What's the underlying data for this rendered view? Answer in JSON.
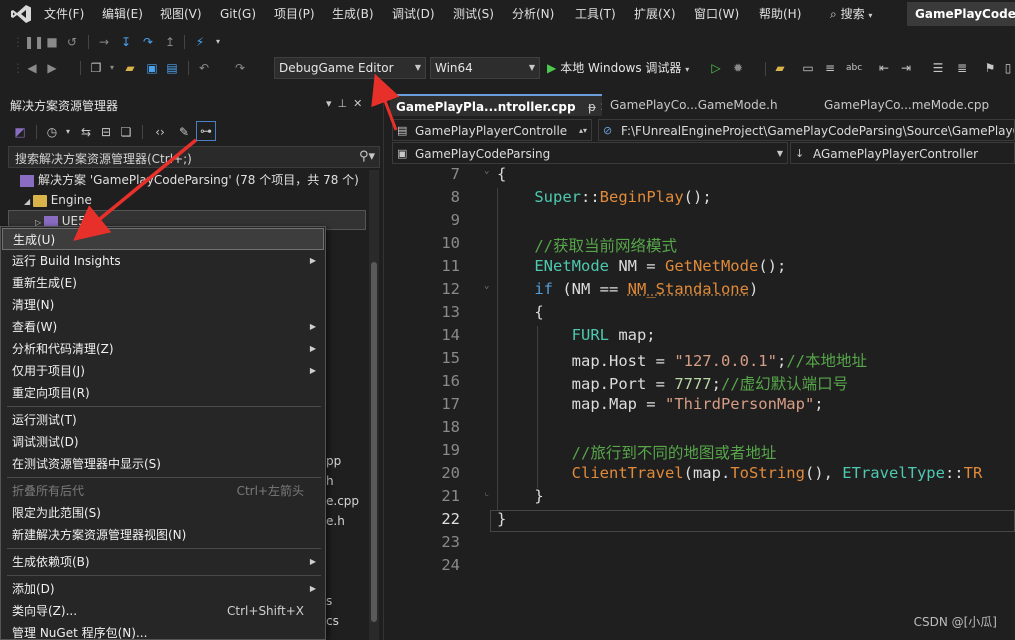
{
  "menu": [
    "文件(F)",
    "编辑(E)",
    "视图(V)",
    "Git(G)",
    "项目(P)",
    "生成(B)",
    "调试(D)",
    "测试(S)",
    "分析(N)",
    "工具(T)",
    "扩展(X)",
    "窗口(W)",
    "帮助(H)"
  ],
  "search_label": "搜索",
  "solution_name": "GamePlayCodeP",
  "toolbar": {
    "config": "DebugGame Editor",
    "platform": "Win64",
    "run_label": "本地 Windows 调试器"
  },
  "solution_explorer": {
    "title": "解决方案资源管理器",
    "search_placeholder": "搜索解决方案资源管理器(Ctrl+;)",
    "solution_row": "解决方案 'GamePlayCodeParsing' (78 个项目，共 78 个)",
    "engine_folder": "Engine",
    "ue_item": "UE5",
    "partial_files": [
      "pp",
      "h",
      "e.cpp",
      "e.h",
      "s",
      "cs"
    ]
  },
  "context_menu": [
    {
      "label": "生成(U)",
      "enabled": true,
      "submenu": false,
      "highlight": true
    },
    {
      "label": "运行 Build Insights",
      "enabled": true,
      "submenu": true
    },
    {
      "label": "重新生成(E)",
      "enabled": true,
      "submenu": false
    },
    {
      "label": "清理(N)",
      "enabled": true,
      "submenu": false
    },
    {
      "label": "查看(W)",
      "enabled": true,
      "submenu": true
    },
    {
      "label": "分析和代码清理(Z)",
      "enabled": true,
      "submenu": true
    },
    {
      "label": "仅用于项目(J)",
      "enabled": true,
      "submenu": true
    },
    {
      "label": "重定向项目(R)",
      "enabled": true,
      "submenu": false
    },
    {
      "label": "运行测试(T)",
      "enabled": true,
      "submenu": false,
      "sep_before": true
    },
    {
      "label": "调试测试(D)",
      "enabled": true,
      "submenu": false
    },
    {
      "label": "在测试资源管理器中显示(S)",
      "enabled": true,
      "submenu": false
    },
    {
      "label": "折叠所有后代",
      "enabled": false,
      "submenu": false,
      "shortcut": "Ctrl+左箭头",
      "sep_before": true
    },
    {
      "label": "限定为此范围(S)",
      "enabled": true,
      "submenu": false
    },
    {
      "label": "新建解决方案资源管理器视图(N)",
      "enabled": true,
      "submenu": false
    },
    {
      "label": "生成依赖项(B)",
      "enabled": true,
      "submenu": true,
      "sep_before": true
    },
    {
      "label": "添加(D)",
      "enabled": true,
      "submenu": true,
      "sep_before": true
    },
    {
      "label": "类向导(Z)...",
      "enabled": true,
      "submenu": false,
      "shortcut": "Ctrl+Shift+X"
    },
    {
      "label": "管理 NuGet 程序包(N)...",
      "enabled": true,
      "submenu": false
    }
  ],
  "editor": {
    "tabs": [
      "GamePlayPla...ntroller.cpp",
      "GamePlayCo...GameMode.h",
      "GamePlayCo...meMode.cpp"
    ],
    "nav_project": "GamePlayPlayerControlle",
    "nav_path": "F:\\FUnrealEngineProject\\GamePlayCodeParsing\\Source\\GamePlayCo",
    "nav_scope": "GamePlayCodeParsing",
    "nav_member": "AGamePlayPlayerController",
    "line_numbers": [
      "7",
      "8",
      "9",
      "10",
      "11",
      "12",
      "13",
      "14",
      "15",
      "16",
      "17",
      "18",
      "19",
      "20",
      "21",
      "22",
      "23",
      "24"
    ],
    "current_line": "22",
    "code": {
      "l7": "{",
      "l8_a": "Super",
      "l8_b": "::",
      "l8_c": "BeginPlay",
      "l8_d": "();",
      "l10": "//获取当前网络模式",
      "l11_a": "ENetMode",
      "l11_b": " NM = ",
      "l11_c": "GetNetMode",
      "l11_d": "();",
      "l12_a": "if",
      "l12_b": " (NM == ",
      "l12_c": "NM_Standalone",
      "l12_d": ")",
      "l13": "{",
      "l14_a": "FURL",
      "l14_b": " map;",
      "l15_a": "map.Host = ",
      "l15_b": "\"127.0.0.1\"",
      "l15_c": ";",
      "l15_d": "//本地地址",
      "l16_a": "map.Port = ",
      "l16_b": "7777",
      "l16_c": ";",
      "l16_d": "//虚幻默认端口号",
      "l17_a": "map.Map = ",
      "l17_b": "\"ThirdPersonMap\"",
      "l17_c": ";",
      "l19": "//旅行到不同的地图或者地址",
      "l20_a": "ClientTravel",
      "l20_b": "(map.",
      "l20_c": "ToString",
      "l20_d": "(), ",
      "l20_e": "ETravelType",
      "l20_f": "::",
      "l20_g": "TR",
      "l21": "}",
      "l22": "}"
    }
  },
  "watermark": "CSDN @[小瓜]",
  "colors": {
    "accent": "#6a9edb",
    "annotation_arrow": "#e8302a",
    "run_green": "#4ec94e"
  }
}
